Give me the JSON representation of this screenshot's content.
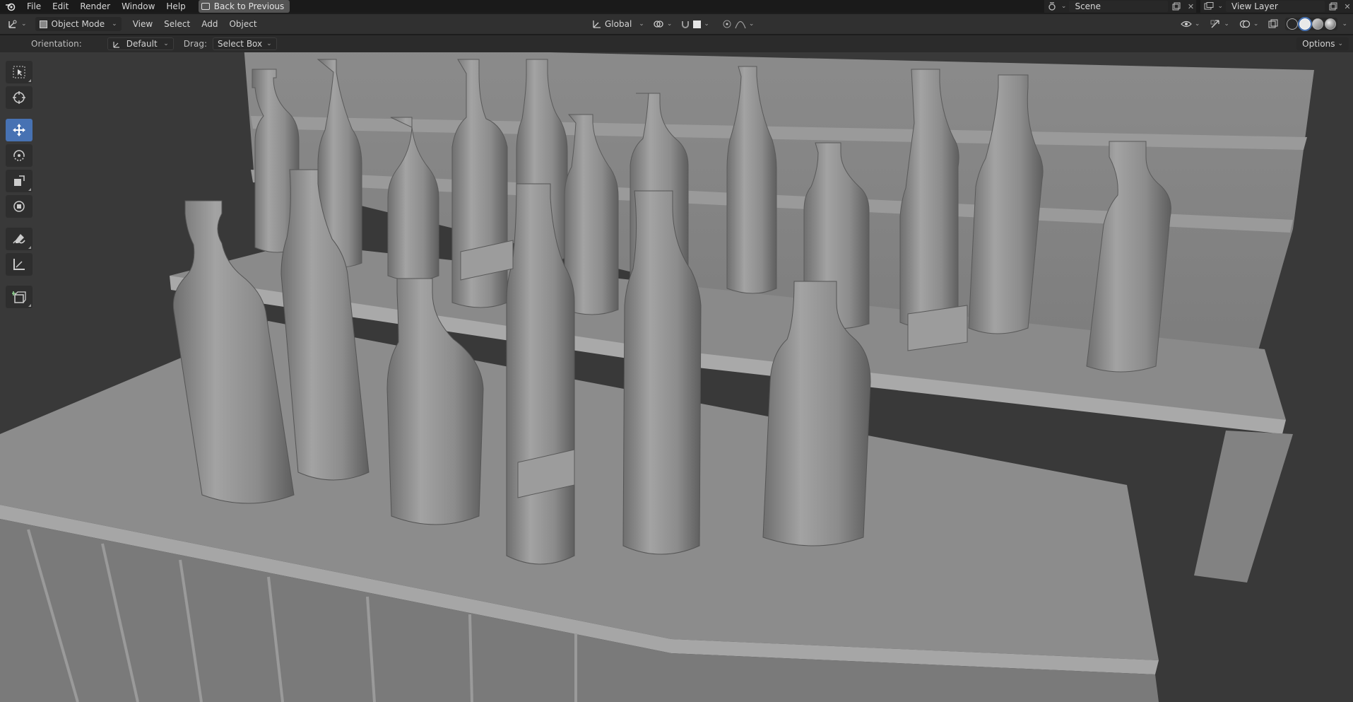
{
  "menubar": {
    "items": [
      "File",
      "Edit",
      "Render",
      "Window",
      "Help"
    ],
    "back_label": "Back to Previous",
    "scene_label": "Scene",
    "view_layer_label": "View Layer"
  },
  "header": {
    "mode_label": "Object Mode",
    "menus": [
      "View",
      "Select",
      "Add",
      "Object"
    ],
    "transform_orientation": "Global"
  },
  "toolsettings": {
    "orientation_label": "Orientation:",
    "orientation_value": "Default",
    "drag_label": "Drag:",
    "drag_value": "Select Box",
    "options_label": "Options"
  },
  "toolbar": {
    "tools": [
      "select-box",
      "cursor",
      "move",
      "rotate",
      "scale",
      "transform",
      "annotate",
      "measure",
      "add-cube"
    ],
    "active": "move"
  },
  "viewport": {
    "shading": "solid",
    "scene_description_icons": [
      "bottle"
    ]
  },
  "colors": {
    "accent": "#4772b3",
    "background": "#393939"
  }
}
